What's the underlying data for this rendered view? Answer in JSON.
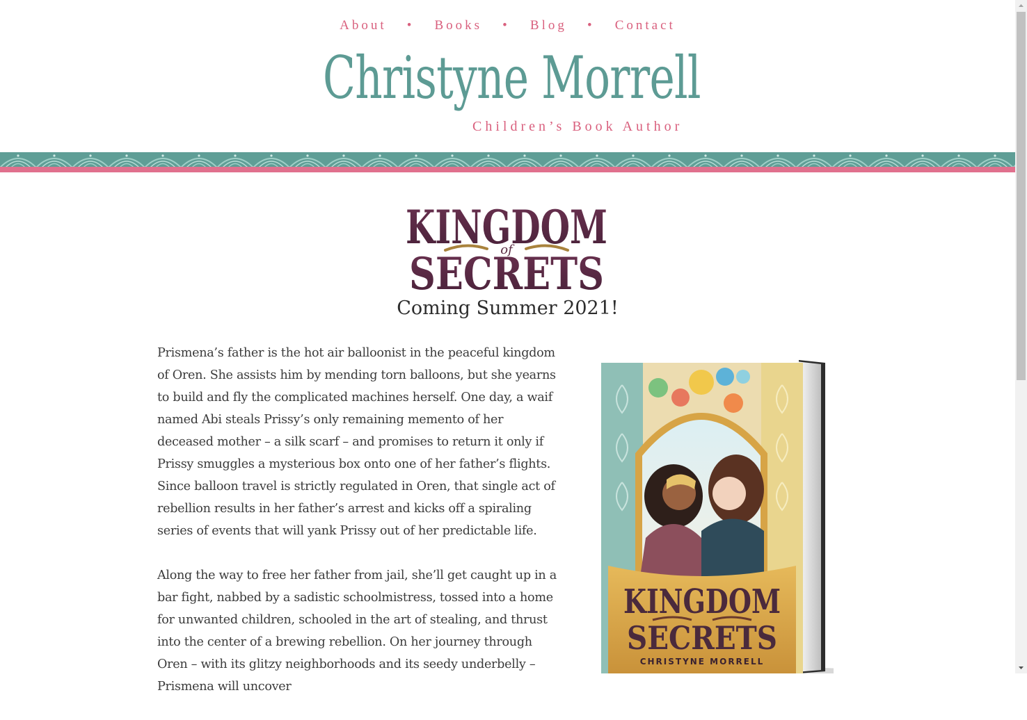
{
  "nav": {
    "items": [
      "About",
      "Books",
      "Blog",
      "Contact"
    ],
    "separator": "•"
  },
  "logo": {
    "name": "Christyne Morrell",
    "subtitle": "Children’s Book Author"
  },
  "book": {
    "title_line1": "KINGDOM",
    "title_of": "of",
    "title_line2": "SECRETS",
    "coming": "Coming Summer 2021!",
    "cover_author": "CHRISTYNE MORRELL",
    "description": [
      "Prismena’s father is the hot air balloonist in the peaceful kingdom of Oren. She assists him by mending torn balloons, but she yearns to build and fly the complicated machines herself. One day, a waif named Abi steals Prissy’s only remaining memento of her deceased mother – a silk scarf – and promises to return it only if Prissy smuggles a mysterious box onto one of her father’s flights. Since balloon travel is strictly regulated in Oren, that single act of rebellion results in her father’s arrest and kicks off a spiraling series of events that will yank Prissy out of her predictable life.",
      "Along the way to free her father from jail, she’ll get caught up in a bar fight, nabbed by a sadistic schoolmistress, tossed into a home for unwanted children, schooled in the art of stealing, and thrust into the center of a brewing rebellion. On her journey through Oren – with its glitzy neighborhoods and its seedy underbelly – Prismena will uncover"
    ]
  },
  "colors": {
    "pink": "#d9607e",
    "teal": "#5d9b94",
    "plum": "#5a2a42"
  }
}
